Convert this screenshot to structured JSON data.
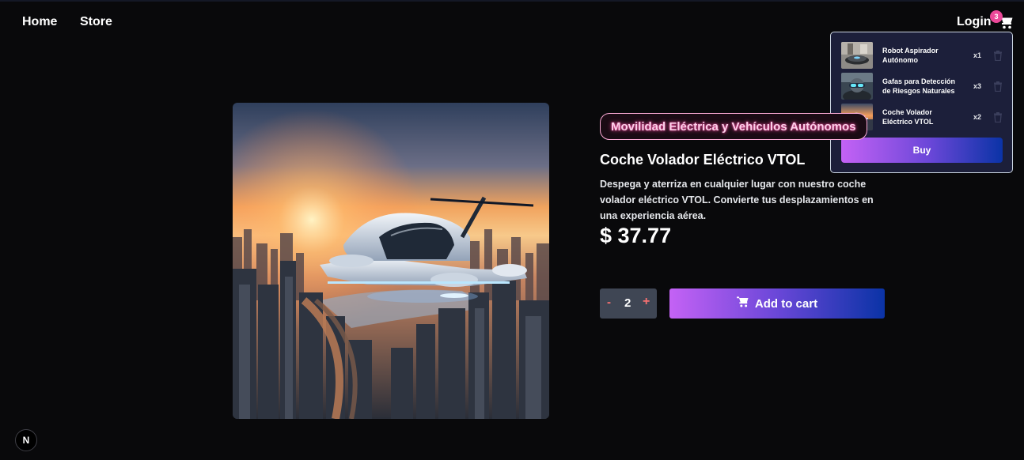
{
  "nav": {
    "home": "Home",
    "store": "Store",
    "login": "Login",
    "cart_icon": "shopping-cart-icon",
    "cart_count": "3"
  },
  "cart": {
    "items": [
      {
        "name": "Robot Aspirador Autónomo",
        "qty": "x1"
      },
      {
        "name": "Gafas para Detección de Riesgos Naturales",
        "qty": "x3"
      },
      {
        "name": "Coche Volador Eléctrico VTOL",
        "qty": "x2"
      }
    ],
    "buy_label": "Buy"
  },
  "product": {
    "category": "Movilidad Eléctrica y Vehículos Autónomos",
    "title": "Coche Volador Eléctrico VTOL",
    "description": "Despega y aterriza en cualquier lugar con nuestro coche volador eléctrico VTOL. Convierte tus desplazamientos en una experiencia aérea.",
    "price": "$ 37.77",
    "quantity": "2",
    "minus": "-",
    "plus": "+",
    "add_to_cart": "Add to cart"
  },
  "next_badge": "N",
  "colors": {
    "background": "#09090b",
    "accent_pink": "#ec4899",
    "gradient_start": "#c462f5",
    "gradient_end": "#0a33a6",
    "panel": "#1c1f3a"
  }
}
